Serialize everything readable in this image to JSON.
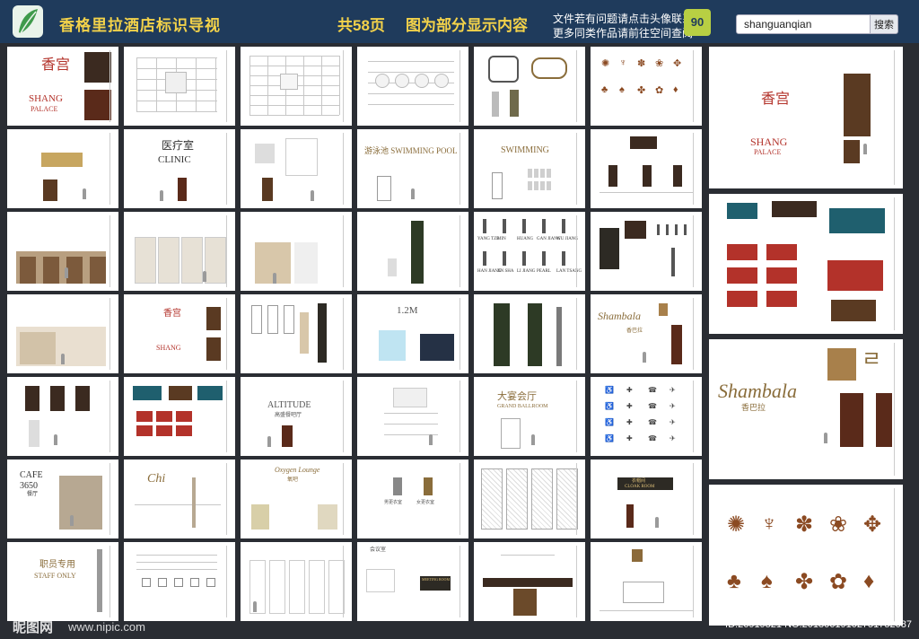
{
  "header": {
    "title": "香格里拉酒店标识导视",
    "pages": "共58页",
    "partial": "图为部分显示内容",
    "notice_1": "文件若有问题请点击头像联系",
    "notice_2": "更多同类作品请前往空间查阅",
    "badge": "90",
    "logo_icon": "leaf-logo-icon"
  },
  "search": {
    "value": "shanguanqian",
    "button": "搜索"
  },
  "watermark": {
    "logo": "昵图网",
    "url": "www.nipic.com",
    "id": "ID:26919821 NO:20180619102751752087"
  },
  "thumbs": {
    "shang_cn": "香宫",
    "shang_en": "SHANG",
    "palace": "PALACE",
    "clinic_cn": "医疗室",
    "clinic_en": "CLINIC",
    "pool": "游泳池 SWIMMING POOL",
    "swimming": "SWIMMING",
    "halls_1": [
      "YANG TZE",
      "MIN",
      "HUANG",
      "GAN JIANG",
      "WU JIANG"
    ],
    "halls_2": [
      "HAN JIANG",
      "JIN SHA",
      "LI JIANG",
      "PEARL",
      "LAN TSANG"
    ],
    "size": "1.2M",
    "shambala": "Shambala",
    "shambala_cn": "香巴拉",
    "shambala_glyph": "ㄹ",
    "altitude": "ALTITUDE",
    "altitude_cn": "高盛餐吧厅",
    "ballroom_cn": "大宴会厅",
    "ballroom_en": "GRAND BALLROOM",
    "cafe": "CAFE",
    "cafe_no": "3650",
    "cafe_cn": "餐厅",
    "chi": "Chi",
    "oxygen": "Oxygen Lounge",
    "oxygen_cn": "氧吧",
    "cloak_cn": "衣帽间",
    "cloak_en": "CLOAK ROOM",
    "staff_cn": "职员专用",
    "staff_en": "STAFF ONLY",
    "meeting_cn": "会议室",
    "meeting_en": "MEETING ROOM",
    "male": "男更衣室",
    "female": "女更衣室"
  },
  "colors": {
    "header": "#1f3b5c",
    "accent": "#f3d24a",
    "gold": "#8a6d3b",
    "red": "#b3322a",
    "brown": "#5a3a22",
    "teal": "#1f5f6e"
  }
}
